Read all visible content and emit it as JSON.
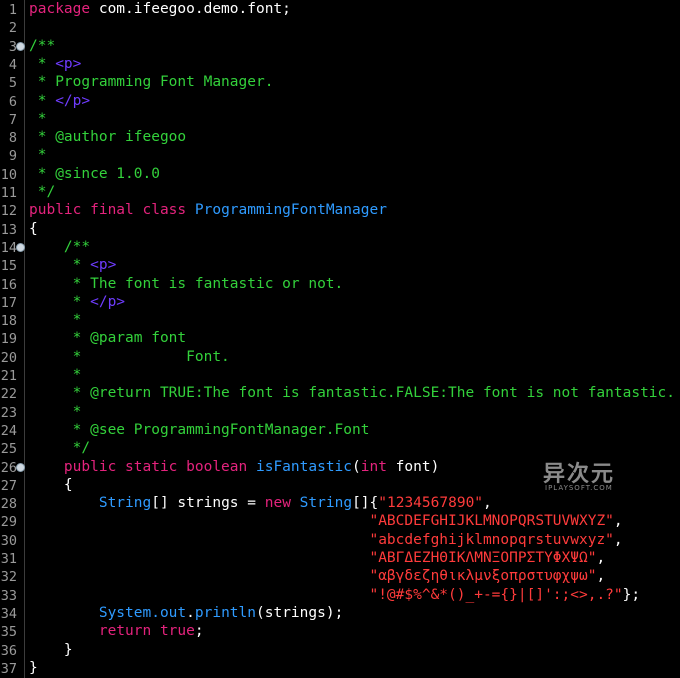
{
  "editor": {
    "lines": [
      {
        "n": "1",
        "segs": [
          {
            "t": "package",
            "c": "kw"
          },
          {
            "t": " com.ifeegoo.demo.font;",
            "c": ""
          }
        ]
      },
      {
        "n": "2",
        "segs": []
      },
      {
        "n": "3",
        "fold": true,
        "segs": [
          {
            "t": "/**",
            "c": "cm"
          }
        ]
      },
      {
        "n": "4",
        "segs": [
          {
            "t": " * ",
            "c": "cm"
          },
          {
            "t": "<p>",
            "c": "tag"
          }
        ]
      },
      {
        "n": "5",
        "segs": [
          {
            "t": " * Programming Font Manager.",
            "c": "cm"
          }
        ]
      },
      {
        "n": "6",
        "segs": [
          {
            "t": " * ",
            "c": "cm"
          },
          {
            "t": "</p>",
            "c": "tag"
          }
        ]
      },
      {
        "n": "7",
        "segs": [
          {
            "t": " *",
            "c": "cm"
          }
        ]
      },
      {
        "n": "8",
        "segs": [
          {
            "t": " * @author ifeegoo",
            "c": "cm"
          }
        ]
      },
      {
        "n": "9",
        "segs": [
          {
            "t": " *",
            "c": "cm"
          }
        ]
      },
      {
        "n": "10",
        "segs": [
          {
            "t": " * @since 1.0.0",
            "c": "cm"
          }
        ]
      },
      {
        "n": "11",
        "segs": [
          {
            "t": " */",
            "c": "cm"
          }
        ]
      },
      {
        "n": "12",
        "segs": [
          {
            "t": "public final class",
            "c": "kw"
          },
          {
            "t": " ",
            "c": ""
          },
          {
            "t": "ProgrammingFontManager",
            "c": "ty"
          }
        ]
      },
      {
        "n": "13",
        "segs": [
          {
            "t": "{",
            "c": ""
          }
        ]
      },
      {
        "n": "14",
        "fold": true,
        "segs": [
          {
            "t": "    /**",
            "c": "cm"
          }
        ]
      },
      {
        "n": "15",
        "segs": [
          {
            "t": "     * ",
            "c": "cm"
          },
          {
            "t": "<p>",
            "c": "tag"
          }
        ]
      },
      {
        "n": "16",
        "segs": [
          {
            "t": "     * The font is fantastic or not.",
            "c": "cm"
          }
        ]
      },
      {
        "n": "17",
        "segs": [
          {
            "t": "     * ",
            "c": "cm"
          },
          {
            "t": "</p>",
            "c": "tag"
          }
        ]
      },
      {
        "n": "18",
        "segs": [
          {
            "t": "     *",
            "c": "cm"
          }
        ]
      },
      {
        "n": "19",
        "segs": [
          {
            "t": "     * @param font",
            "c": "cm"
          }
        ]
      },
      {
        "n": "20",
        "segs": [
          {
            "t": "     *            Font.",
            "c": "cm"
          }
        ]
      },
      {
        "n": "21",
        "segs": [
          {
            "t": "     *",
            "c": "cm"
          }
        ]
      },
      {
        "n": "22",
        "segs": [
          {
            "t": "     * @return TRUE:The font is fantastic.FALSE:The font is not fantastic.",
            "c": "cm"
          }
        ]
      },
      {
        "n": "23",
        "segs": [
          {
            "t": "     *",
            "c": "cm"
          }
        ]
      },
      {
        "n": "24",
        "segs": [
          {
            "t": "     * @see ProgrammingFontManager.Font",
            "c": "cm"
          }
        ]
      },
      {
        "n": "25",
        "segs": [
          {
            "t": "     */",
            "c": "cm"
          }
        ]
      },
      {
        "n": "26",
        "fold": true,
        "segs": [
          {
            "t": "    public static boolean",
            "c": "kw"
          },
          {
            "t": " ",
            "c": ""
          },
          {
            "t": "isFantastic",
            "c": "ty"
          },
          {
            "t": "(",
            "c": ""
          },
          {
            "t": "int",
            "c": "kw"
          },
          {
            "t": " font)",
            "c": ""
          }
        ]
      },
      {
        "n": "27",
        "segs": [
          {
            "t": "    {",
            "c": ""
          }
        ]
      },
      {
        "n": "28",
        "segs": [
          {
            "t": "        ",
            "c": ""
          },
          {
            "t": "String",
            "c": "ty"
          },
          {
            "t": "[] strings = ",
            "c": ""
          },
          {
            "t": "new",
            "c": "kw"
          },
          {
            "t": " ",
            "c": ""
          },
          {
            "t": "String",
            "c": "ty"
          },
          {
            "t": "[]{",
            "c": ""
          },
          {
            "t": "\"1234567890\"",
            "c": "str"
          },
          {
            "t": ",",
            "c": ""
          }
        ]
      },
      {
        "n": "29",
        "segs": [
          {
            "t": "                                       ",
            "c": ""
          },
          {
            "t": "\"ABCDEFGHIJKLMNOPQRSTUVWXYZ\"",
            "c": "str"
          },
          {
            "t": ",",
            "c": ""
          }
        ]
      },
      {
        "n": "30",
        "segs": [
          {
            "t": "                                       ",
            "c": ""
          },
          {
            "t": "\"abcdefghijklmnopqrstuvwxyz\"",
            "c": "str"
          },
          {
            "t": ",",
            "c": ""
          }
        ]
      },
      {
        "n": "31",
        "segs": [
          {
            "t": "                                       ",
            "c": ""
          },
          {
            "t": "\"ΑΒΓΔΕΖΗΘΙΚΛΜΝΞΟΠΡΣΤΥΦΧΨΩ\"",
            "c": "str"
          },
          {
            "t": ",",
            "c": ""
          }
        ]
      },
      {
        "n": "32",
        "segs": [
          {
            "t": "                                       ",
            "c": ""
          },
          {
            "t": "\"αβγδεζηθικλμνξοπρστυφχψω\"",
            "c": "str"
          },
          {
            "t": ",",
            "c": ""
          }
        ]
      },
      {
        "n": "33",
        "segs": [
          {
            "t": "                                       ",
            "c": ""
          },
          {
            "t": "\"!@#$%^&*()_+-={}|[]':;<>,.?\"",
            "c": "str"
          },
          {
            "t": "};",
            "c": ""
          }
        ]
      },
      {
        "n": "34",
        "segs": [
          {
            "t": "        System.",
            "c": "ty"
          },
          {
            "t": "out",
            "c": "ty"
          },
          {
            "t": ".",
            "c": ""
          },
          {
            "t": "println",
            "c": "ty"
          },
          {
            "t": "(strings);",
            "c": ""
          }
        ]
      },
      {
        "n": "35",
        "segs": [
          {
            "t": "        ",
            "c": ""
          },
          {
            "t": "return true",
            "c": "kw"
          },
          {
            "t": ";",
            "c": ""
          }
        ]
      },
      {
        "n": "36",
        "segs": [
          {
            "t": "    }",
            "c": ""
          }
        ]
      },
      {
        "n": "37",
        "segs": [
          {
            "t": "}",
            "c": ""
          }
        ]
      }
    ]
  },
  "watermark": {
    "main": "异次元",
    "sub": "IPLAYSOFT.COM"
  },
  "colors": {
    "keyword": "#e4237d",
    "comment": "#33d13b",
    "tag": "#6f3cff",
    "type": "#2f9bff",
    "string": "#ff3b3b",
    "text": "#ffffff",
    "background": "#000000"
  }
}
